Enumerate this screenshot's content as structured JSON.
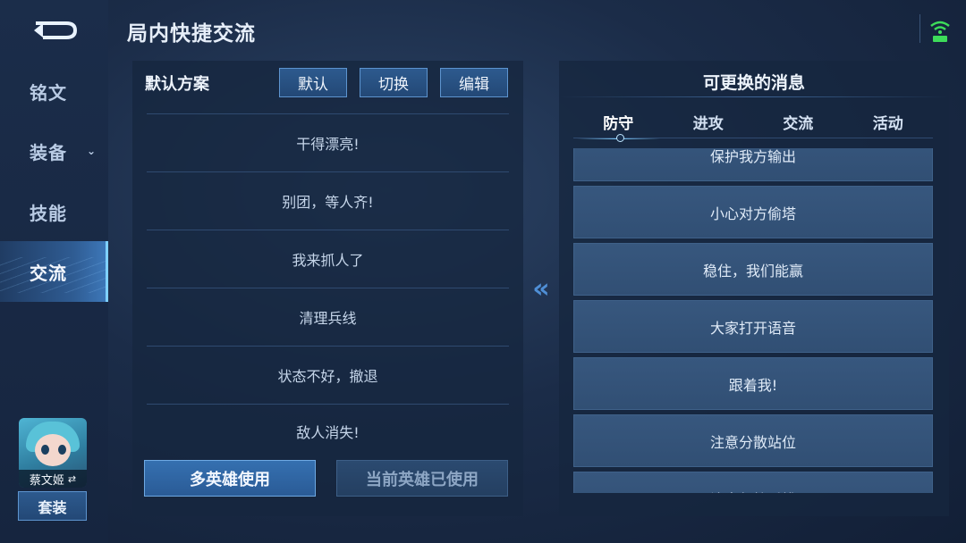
{
  "header": {
    "title": "局内快捷交流"
  },
  "sidebar": {
    "items": [
      {
        "label": "铭文"
      },
      {
        "label": "装备"
      },
      {
        "label": "技能"
      },
      {
        "label": "交流"
      }
    ],
    "hero_name": "蔡文姬",
    "suit_label": "套装"
  },
  "left_panel": {
    "scheme_label": "默认方案",
    "buttons": {
      "default": "默认",
      "switch": "切换",
      "edit": "编辑"
    },
    "phrases": [
      "干得漂亮!",
      "别团，等人齐!",
      "我来抓人了",
      "清理兵线",
      "状态不好，撤退",
      "敌人消失!"
    ],
    "multi_hero_label": "多英雄使用",
    "current_hero_label": "当前英雄已使用"
  },
  "right_panel": {
    "title": "可更换的消息",
    "tabs": [
      "防守",
      "进攻",
      "交流",
      "活动"
    ],
    "messages": [
      "保护我方输出",
      "小心对方偷塔",
      "稳住，我们能赢",
      "大家打开语音",
      "跟着我!",
      "注意分散站位",
      "注意保护后排"
    ]
  },
  "colors": {
    "accent": "#7fcfff",
    "button": "#2d5a8e",
    "signal": "#3ddc5a"
  }
}
